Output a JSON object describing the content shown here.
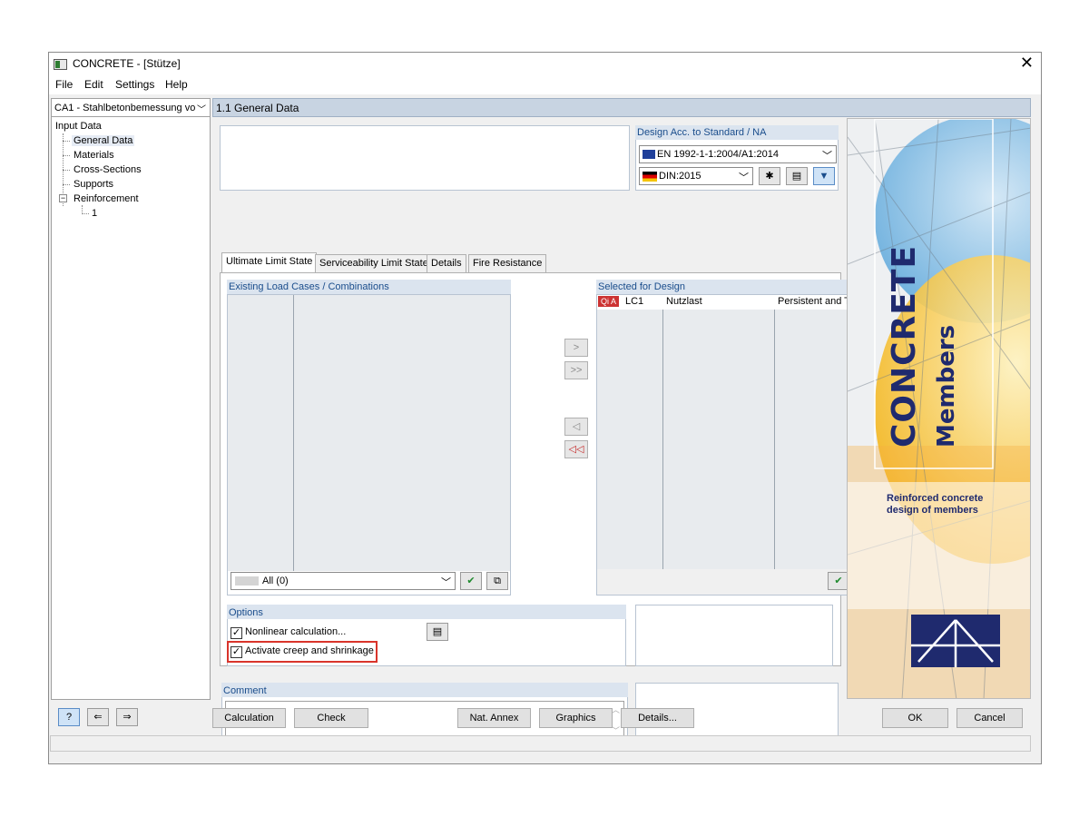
{
  "window": {
    "title": "CONCRETE - [Stütze]"
  },
  "menu": [
    "File",
    "Edit",
    "Settings",
    "Help"
  ],
  "case_selector": {
    "value": "CA1 - Stahlbetonbemessung vo"
  },
  "tree": {
    "root": "Input Data",
    "items": [
      "General Data",
      "Materials",
      "Cross-Sections",
      "Supports"
    ],
    "reinforcement": "Reinforcement",
    "reinforcement_child": "1"
  },
  "section_title": "1.1 General Data",
  "design_standard": {
    "heading": "Design Acc. to Standard / NA",
    "standard": "EN 1992-1-1:2004/A1:2014",
    "national_annex": "DIN:2015"
  },
  "tabs": [
    "Ultimate Limit State",
    "Serviceability Limit State",
    "Details",
    "Fire Resistance"
  ],
  "existing": {
    "heading": "Existing Load Cases / Combinations",
    "filter": "All (0)"
  },
  "selected": {
    "heading": "Selected for Design",
    "rows": [
      {
        "badge": "Qi A",
        "id": "LC1",
        "name": "Nutzlast",
        "situation": "Persistent and Transie"
      }
    ]
  },
  "transfer_buttons": {
    "add": ">",
    "add_all": ">>",
    "remove": "◁",
    "remove_all": "◁◁"
  },
  "options": {
    "heading": "Options",
    "nonlinear": "Nonlinear calculation...",
    "creep": "Activate creep and shrinkage"
  },
  "comment": {
    "heading": "Comment",
    "value": ""
  },
  "banner": {
    "title": "CONCRETE",
    "subtitle": "Members",
    "description_line1": "Reinforced concrete",
    "description_line2": "design of members"
  },
  "bottom_buttons": {
    "calculation": "Calculation",
    "check": "Check",
    "nat_annex": "Nat. Annex",
    "graphics": "Graphics",
    "details": "Details...",
    "ok": "OK",
    "cancel": "Cancel"
  },
  "colors": {
    "section_header": "#c8d4e2",
    "group_heading": "#1a4d8c",
    "highlight": "#d9342b",
    "badge": "#cc3333",
    "banner_blue": "#1f2a6e"
  }
}
